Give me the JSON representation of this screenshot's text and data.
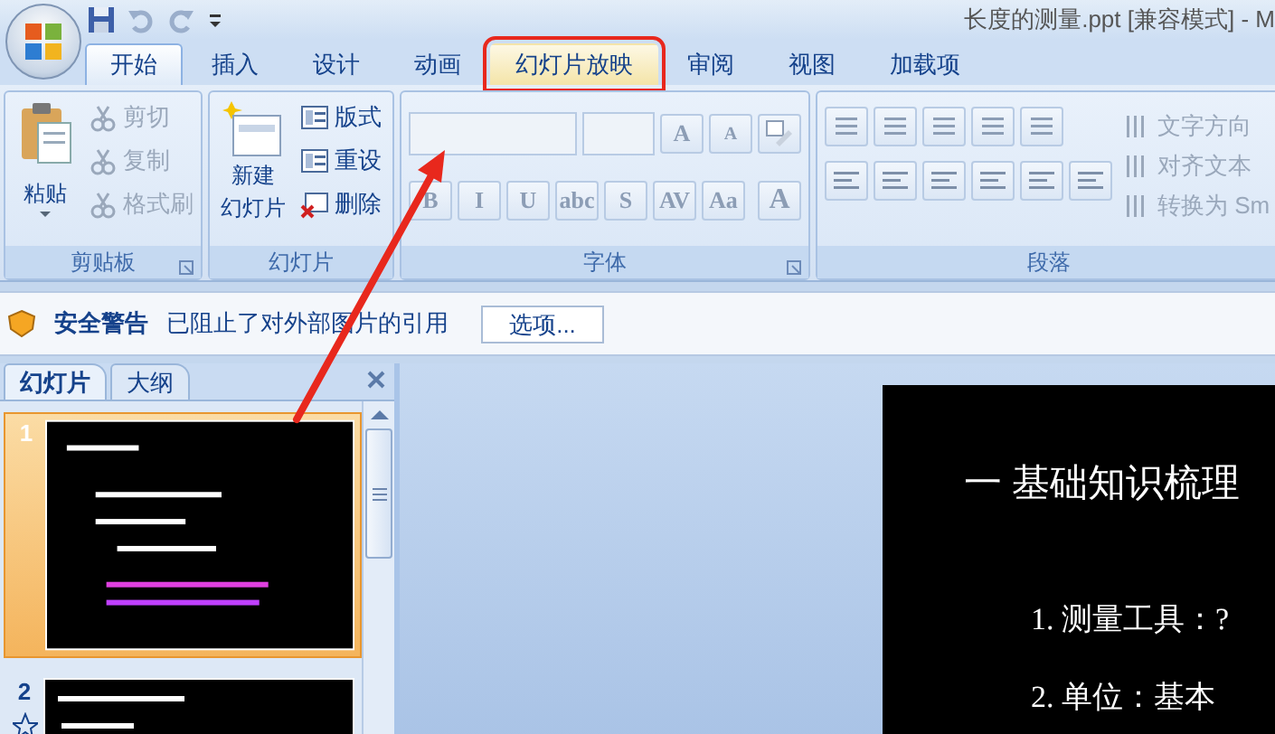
{
  "window": {
    "title": "长度的测量.ppt [兼容模式] - M"
  },
  "tabs": [
    {
      "label": "开始",
      "selected": true,
      "marked": false
    },
    {
      "label": "插入",
      "selected": false,
      "marked": false
    },
    {
      "label": "设计",
      "selected": false,
      "marked": false
    },
    {
      "label": "动画",
      "selected": false,
      "marked": false
    },
    {
      "label": "幻灯片放映",
      "selected": false,
      "marked": true
    },
    {
      "label": "审阅",
      "selected": false,
      "marked": false
    },
    {
      "label": "视图",
      "selected": false,
      "marked": false
    },
    {
      "label": "加载项",
      "selected": false,
      "marked": false
    }
  ],
  "clipboard": {
    "label": "剪贴板",
    "paste": "粘贴",
    "items": [
      {
        "label": "剪切",
        "disabled": true
      },
      {
        "label": "复制",
        "disabled": true
      },
      {
        "label": "格式刷",
        "disabled": true
      }
    ]
  },
  "slides_group": {
    "label": "幻灯片",
    "new_slide": [
      "新建",
      "幻灯片"
    ],
    "items": [
      {
        "label": "版式",
        "disabled": false
      },
      {
        "label": "重设",
        "disabled": false
      },
      {
        "label": "删除",
        "disabled": false
      }
    ]
  },
  "font": {
    "label": "字体",
    "grow": "A",
    "shrink": "A",
    "buttons": [
      "B",
      "I",
      "U",
      "abc",
      "S",
      "AV",
      "Aa"
    ],
    "color_button": "A"
  },
  "paragraph": {
    "label": "段落",
    "items": [
      {
        "label": "文字方向",
        "disabled": true
      },
      {
        "label": "对齐文本",
        "disabled": true
      },
      {
        "label": "转换为 Sm",
        "disabled": true
      }
    ]
  },
  "security": {
    "title": "安全警告",
    "message": "已阻止了对外部图片的引用",
    "button": "选项..."
  },
  "pane": {
    "tabs": [
      {
        "label": "幻灯片",
        "selected": true
      },
      {
        "label": "大纲",
        "selected": false
      }
    ],
    "thumbnails": [
      {
        "number": "1",
        "selected": true,
        "animated": false
      },
      {
        "number": "2",
        "selected": false,
        "animated": true
      }
    ]
  },
  "slide": {
    "lines": [
      {
        "kind": "heading",
        "text": "一  基础知识梳理"
      },
      {
        "kind": "item",
        "text": "1. 测量工具：?"
      },
      {
        "kind": "item",
        "text": "2. 单位：基本"
      }
    ]
  }
}
